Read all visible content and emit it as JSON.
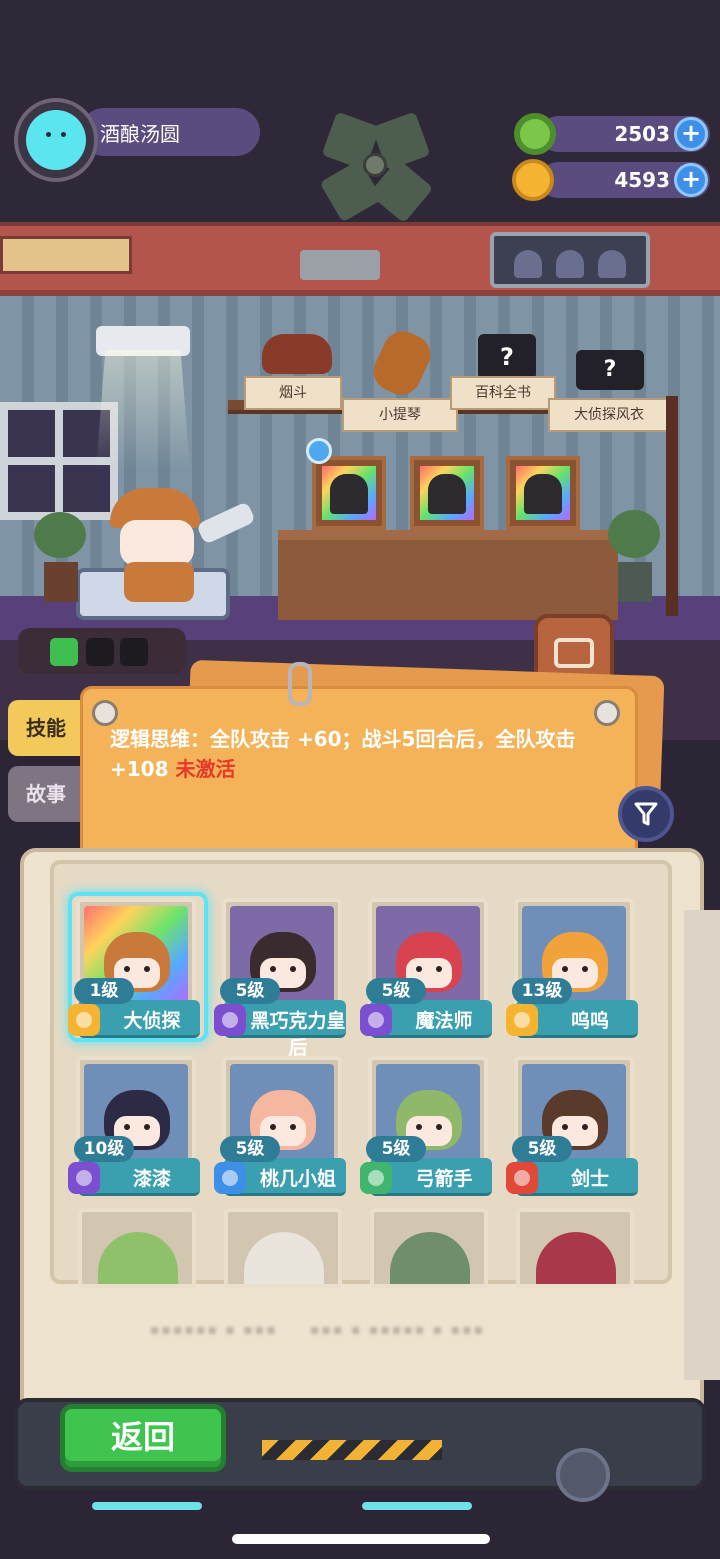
{
  "player": {
    "name": "酒酿汤圆"
  },
  "currencies": [
    {
      "icon": "green-donut-icon",
      "value": "2503",
      "color": "#7cc74a"
    },
    {
      "icon": "gold-planet-coin-icon",
      "value": "4593",
      "color": "#f4b431"
    }
  ],
  "shelf_items": [
    {
      "label": "烟斗",
      "icon": "pipe-icon"
    },
    {
      "label": "小提琴",
      "icon": "violin-icon"
    },
    {
      "label": "百科全书",
      "icon": "unknown-book-icon"
    },
    {
      "label": "大侦探风衣",
      "icon": "unknown-coat-icon"
    }
  ],
  "tabs": {
    "skill": "技能",
    "story": "故事"
  },
  "skill": {
    "text": "逻辑思维：全队攻击 +60；战斗5回合后，全队攻击 +108",
    "status": "未激活"
  },
  "characters": [
    {
      "level": "1级",
      "name": "大侦探",
      "rank_color": "#f4b431",
      "hair": "#c97a3a",
      "bg": "rainbow",
      "selected": true
    },
    {
      "level": "5级",
      "name": "黑巧克力皇后",
      "rank_color": "#7b4fd0",
      "hair": "#3a2b2e",
      "bg": "#7f6aa8",
      "selected": false
    },
    {
      "level": "5级",
      "name": "魔法师",
      "rank_color": "#7b4fd0",
      "hair": "#d8434f",
      "bg": "#7f6aa8",
      "selected": false
    },
    {
      "level": "13级",
      "name": "呜呜",
      "rank_color": "#f4b431",
      "hair": "#f2a23a",
      "bg": "#6f8fb8",
      "selected": false
    },
    {
      "level": "10级",
      "name": "漆漆",
      "rank_color": "#7b4fd0",
      "hair": "#2c2a44",
      "bg": "#6f8fb8",
      "selected": false
    },
    {
      "level": "5级",
      "name": "桃几小姐",
      "rank_color": "#3e8fe8",
      "hair": "#f6b7a0",
      "bg": "#6f8fb8",
      "selected": false
    },
    {
      "level": "5级",
      "name": "弓箭手",
      "rank_color": "#3fb56f",
      "hair": "#8fb86a",
      "bg": "#6f8fb8",
      "selected": false
    },
    {
      "level": "5级",
      "name": "剑士",
      "rank_color": "#e0483a",
      "hair": "#5a3a2a",
      "bg": "#6f8fb8",
      "selected": false
    }
  ],
  "buttons": {
    "back": "返回"
  }
}
